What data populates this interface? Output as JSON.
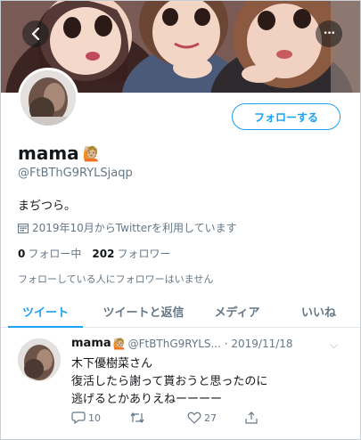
{
  "header": {
    "back_icon": "back-arrow-icon",
    "more_icon": "more-dots-icon",
    "more_glyph": "•••"
  },
  "profile": {
    "name": "mama",
    "name_emoji": "🙋🏼",
    "handle": "@FtBThG9RYLSjaqp",
    "bio": "まぢつら。",
    "joined": "2019年10月からTwitterを利用しています",
    "following_count": "0",
    "following_label": "フォロー中",
    "followers_count": "202",
    "followers_label": "フォロワー",
    "followers_note": "フォローしている人にフォロワーはいません",
    "follow_button": "フォローする"
  },
  "tabs": [
    {
      "label": "ツイート",
      "active": true
    },
    {
      "label": "ツイートと返信",
      "active": false
    },
    {
      "label": "メディア",
      "active": false
    },
    {
      "label": "いいね",
      "active": false
    }
  ],
  "tweet": {
    "name": "mama",
    "name_emoji": "🙋🏼",
    "handle_date": "@FtBThG9RYLS... · 2019/11/18",
    "caret": "⌵",
    "lines": [
      "木下優樹菜さん",
      "復活したら謝って貰おうと思ったのに",
      "逃げるとかありえねーーーー"
    ],
    "reply_count": "10",
    "retweet_count": "",
    "like_count": "27"
  },
  "colors": {
    "accent": "#1da1f2",
    "secondary_text": "#657786"
  }
}
